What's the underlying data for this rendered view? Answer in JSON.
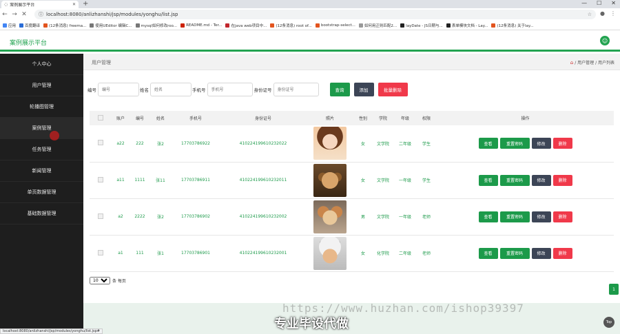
{
  "browser": {
    "tab_title": "案例展示平台",
    "new_tab": "+",
    "url": "localhost:8080/anlizhanshi/jsp/modules/yonghu/list.jsp",
    "bookmarks": [
      {
        "label": "应用",
        "color": "#4285f4"
      },
      {
        "label": "百度翻译",
        "color": "#2a6cd6"
      },
      {
        "label": "(12条消息) freema...",
        "color": "#e2541e"
      },
      {
        "label": "使用UEditor 编辑C...",
        "color": "#777777"
      },
      {
        "label": "mysql如何修改roo...",
        "color": "#777777"
      },
      {
        "label": "README.md - Ter...",
        "color": "#cc2200"
      },
      {
        "label": "在java web项目中...",
        "color": "#c1272d"
      },
      {
        "label": "(12条消息) root of...",
        "color": "#e2541e"
      },
      {
        "label": "bootstrap-select...",
        "color": "#e2541e"
      },
      {
        "label": "如何用正则匹配2...",
        "color": "#999999"
      },
      {
        "label": "layDate - JS日期与...",
        "color": "#222222"
      },
      {
        "label": "表单模块文档 - Lay...",
        "color": "#222222"
      },
      {
        "label": "(12条消息) 关于lay...",
        "color": "#e2541e"
      }
    ],
    "status_url": "localhost:8080/anlizhanshi/jsp/modules/yonghu/list.jsp#"
  },
  "header": {
    "brand": "案例展示平台"
  },
  "sidebar": {
    "items": [
      {
        "label": "个人中心"
      },
      {
        "label": "用户管理"
      },
      {
        "label": "轮播图管理"
      },
      {
        "label": "案例管理"
      },
      {
        "label": "任务管理"
      },
      {
        "label": "新闻管理"
      },
      {
        "label": "单页数据管理"
      },
      {
        "label": "基础数据管理"
      }
    ]
  },
  "breadcrumb": {
    "title": "用户管理",
    "path": "/ 用户管理 / 用户列表"
  },
  "search": {
    "labels": {
      "bianhao": "编号",
      "name": "姓名",
      "phone": "手机号",
      "idcard": "身份证号"
    },
    "placeholders": {
      "bianhao": "编号",
      "name": "姓名",
      "phone": "手机号",
      "idcard": "身份证号"
    },
    "query_button": "查询",
    "add_button": "添加",
    "batch_delete_button": "批量删除"
  },
  "table": {
    "headers": [
      "账户",
      "编号",
      "姓名",
      "手机号",
      "身份证号",
      "照片",
      "性别",
      "学院",
      "年级",
      "权限",
      "操作"
    ],
    "rows": [
      {
        "account": "a22",
        "code": "222",
        "name": "张2",
        "phone": "17703786922",
        "idcard": "410224199610232022",
        "photo": "girl-photo",
        "gender": "女",
        "college": "文学院",
        "grade": "二年级",
        "role": "学生"
      },
      {
        "account": "a11",
        "code": "1111",
        "name": "张11",
        "phone": "17703786911",
        "idcard": "410224199610232011",
        "photo": "puppy-photo",
        "gender": "女",
        "college": "文学院",
        "grade": "一年级",
        "role": "学生"
      },
      {
        "account": "a2",
        "code": "2222",
        "name": "张2",
        "phone": "17703786902",
        "idcard": "410224199610232002",
        "photo": "shiba-photo",
        "gender": "男",
        "college": "文学院",
        "grade": "一年级",
        "role": "老师"
      },
      {
        "account": "a1",
        "code": "111",
        "name": "张1",
        "phone": "17703786901",
        "idcard": "410224199610232001",
        "photo": "kitten-photo",
        "gender": "女",
        "college": "化学院",
        "grade": "二年级",
        "role": "老师"
      }
    ],
    "ops": {
      "view": "查看",
      "reset_pwd": "重置密码",
      "edit": "修改",
      "delete": "删除"
    }
  },
  "pager": {
    "page_size": "10",
    "per_page_label": "条 每页",
    "current_page": "1"
  },
  "overlay": {
    "watermark": "https://www.huzhan.com/ishop39397",
    "caption": "专业毕设代做",
    "top_button": "Top"
  },
  "colors": {
    "accent": "#22a350",
    "danger": "#f0394a",
    "dark": "#3c4556",
    "sidebar": "#1e1e1e"
  }
}
